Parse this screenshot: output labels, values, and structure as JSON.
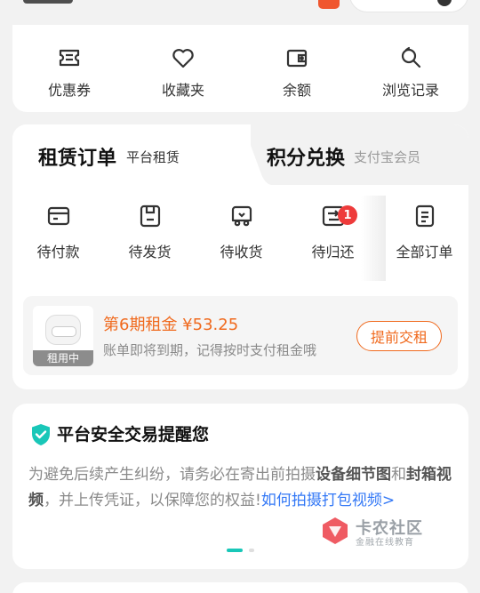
{
  "quick_access": [
    {
      "label": "优惠券",
      "icon": "coupon-icon"
    },
    {
      "label": "收藏夹",
      "icon": "heart-icon"
    },
    {
      "label": "余额",
      "icon": "wallet-icon"
    },
    {
      "label": "浏览记录",
      "icon": "history-icon"
    }
  ],
  "order_tabs": {
    "left": {
      "title": "租赁订单",
      "subtitle": "平台租赁"
    },
    "right": {
      "title": "积分兑换",
      "subtitle": "支付宝会员"
    }
  },
  "order_statuses": [
    {
      "label": "待付款",
      "icon": "pending-payment-icon"
    },
    {
      "label": "待发货",
      "icon": "pending-shipment-icon"
    },
    {
      "label": "待收货",
      "icon": "pending-receipt-icon"
    },
    {
      "label": "待归还",
      "icon": "pending-return-icon",
      "badge": "1"
    },
    {
      "label": "全部订单",
      "icon": "all-orders-icon"
    }
  ],
  "rental": {
    "title": "第6期租金 ¥53.25",
    "description": "账单即将到期，记得按时支付租金哦",
    "status": "租用中",
    "button": "提前交租"
  },
  "safety": {
    "title": "平台安全交易提醒您",
    "text_1": "为避免后续产生纠纷，请务必在寄出前拍摄",
    "bold_1": "设备细节图",
    "text_2": "和",
    "bold_2": "封箱视频",
    "text_3": "，并上传凭证，以保障您的权益!",
    "link": "如何拍摄打包视频>"
  },
  "watermark": {
    "name": "卡农社区",
    "sub": "金融在线教育"
  },
  "colors": {
    "accent": "#f06a1e",
    "teal": "#19c7b8",
    "link": "#3378f6",
    "badge": "#ee3b3b"
  }
}
